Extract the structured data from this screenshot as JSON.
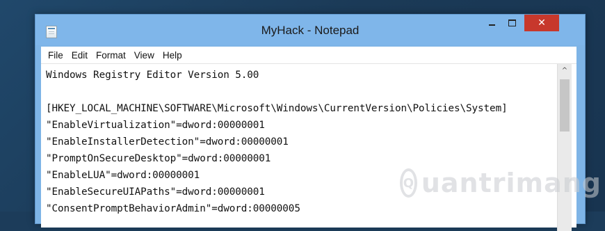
{
  "window": {
    "title": "MyHack - Notepad",
    "close_glyph": "✕"
  },
  "menu": {
    "items": [
      "File",
      "Edit",
      "Format",
      "View",
      "Help"
    ]
  },
  "editor": {
    "lines": [
      "Windows Registry Editor Version 5.00",
      "",
      "[HKEY_LOCAL_MACHINE\\SOFTWARE\\Microsoft\\Windows\\CurrentVersion\\Policies\\System]",
      "\"EnableVirtualization\"=dword:00000001",
      "\"EnableInstallerDetection\"=dword:00000001",
      "\"PromptOnSecureDesktop\"=dword:00000001",
      "\"EnableLUA\"=dword:00000001",
      "\"EnableSecureUIAPaths\"=dword:00000001",
      "\"ConsentPromptBehaviorAdmin\"=dword:00000005"
    ]
  },
  "scrollbar": {
    "up_glyph": "^"
  },
  "watermark": {
    "text": "uantrimang",
    "logo_glyph": "Q"
  },
  "colors": {
    "titlebar": "#7fb6ea",
    "close_button": "#c7382c",
    "desktop": "#1c3c5a"
  }
}
